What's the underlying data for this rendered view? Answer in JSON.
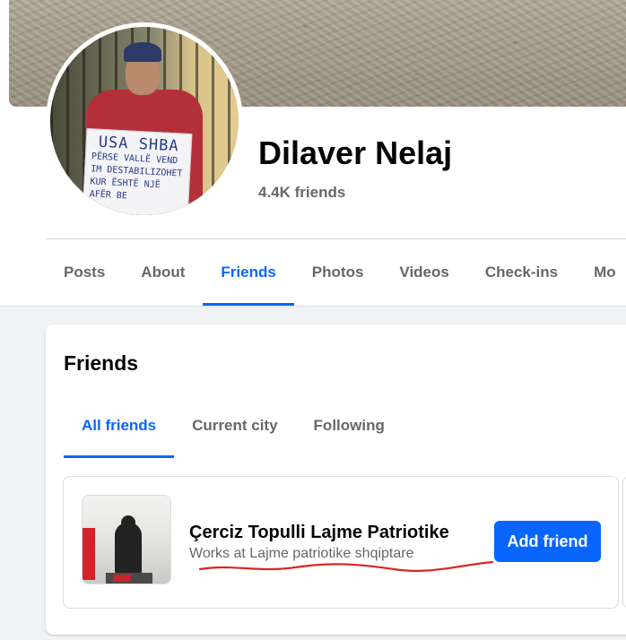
{
  "profile": {
    "name": "Dilaver Nelaj",
    "friends_count": "4.4K friends",
    "avatar_sign": {
      "line1": "USA SHBA",
      "lines": [
        "PËRSE VALLË VEND",
        "IM DESTABILIZOHET",
        "KUR ËSHTË NJË",
        "AFËR BE"
      ]
    }
  },
  "tabs": [
    {
      "label": "Posts",
      "active": false
    },
    {
      "label": "About",
      "active": false
    },
    {
      "label": "Friends",
      "active": true
    },
    {
      "label": "Photos",
      "active": false
    },
    {
      "label": "Videos",
      "active": false
    },
    {
      "label": "Check-ins",
      "active": false
    },
    {
      "label": "Mo",
      "active": false
    }
  ],
  "friends_section": {
    "title": "Friends",
    "subtabs": [
      {
        "label": "All friends",
        "active": true
      },
      {
        "label": "Current city",
        "active": false
      },
      {
        "label": "Following",
        "active": false
      }
    ],
    "friends": [
      {
        "name": "Çerciz Topulli Lajme Patriotike",
        "work": "Works at Lajme patriotike shqiptare",
        "button_label": "Add friend"
      }
    ]
  },
  "colors": {
    "accent": "#0866ff",
    "secondary_text": "#65676b",
    "annotation_red": "#d9281f"
  }
}
